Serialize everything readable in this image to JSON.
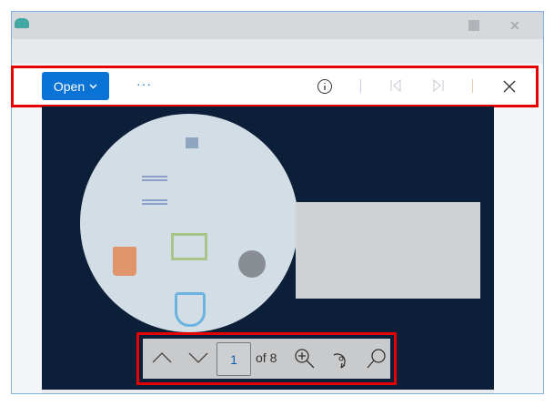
{
  "toolbar": {
    "open_label": "Open",
    "more_label": "···"
  },
  "pager": {
    "current_page": "1",
    "of_label": "of 8"
  },
  "colors": {
    "accent": "#0a74d6",
    "highlight": "#e60000",
    "viewer_bg": "#0b1f38"
  }
}
